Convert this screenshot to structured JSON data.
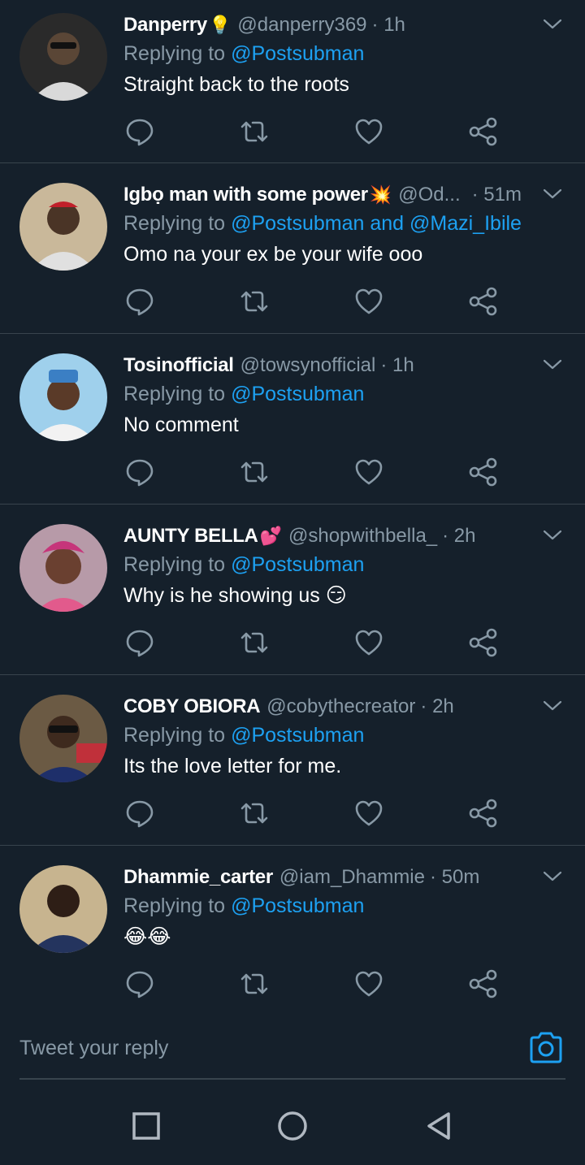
{
  "tweets": [
    {
      "name": "Danperry",
      "emoji": "💡",
      "handle": "@danperry369",
      "time": "· 1h",
      "replying_prefix": "Replying to",
      "mentions": "@Postsubman",
      "text": "Straight back to the roots",
      "avatar_color": "#3a3a3a"
    },
    {
      "name": "Igbọ man with some power",
      "emoji": "💥",
      "handle": "@Od...",
      "time": "· 51m",
      "replying_prefix": "Replying to",
      "mentions": "@Postsubman and @Mazi_Ibile",
      "text": "Omo na your ex be your wife ooo",
      "avatar_color": "#8a7a62"
    },
    {
      "name": "Tosinofficial",
      "emoji": "",
      "handle": "@towsynofficial",
      "time": "· 1h",
      "replying_prefix": "Replying to",
      "mentions": "@Postsubman",
      "text": "No comment",
      "avatar_color": "#6fa8c9"
    },
    {
      "name": "AUNTY BELLA",
      "emoji": "💕",
      "handle": "@shopwithbella_",
      "time": "· 2h",
      "replying_prefix": "Replying to",
      "mentions": "@Postsubman",
      "text": "Why is he showing us 😏",
      "avatar_color": "#a88a9c"
    },
    {
      "name": "COBY OBIORA",
      "emoji": "",
      "handle": "@cobythecreator",
      "time": "· 2h",
      "replying_prefix": "Replying to",
      "mentions": "@Postsubman",
      "text": "Its the love letter for me.",
      "avatar_color": "#5b4a3a"
    },
    {
      "name": "Dhammie_carter",
      "emoji": "",
      "handle": "@iam_Dhammie",
      "time": "· 50m",
      "replying_prefix": "Replying to",
      "mentions": "@Postsubman",
      "text": "😂😂",
      "avatar_color": "#2f3d5a"
    }
  ],
  "composer": {
    "placeholder": "Tweet your reply",
    "camera_icon": "camera-icon"
  },
  "colors": {
    "background": "#15202b",
    "divider": "#38444d",
    "secondary_text": "#8899a6",
    "accent": "#1da1f2"
  },
  "nav": {
    "icons": [
      "recents-square-icon",
      "home-circle-icon",
      "back-triangle-icon"
    ]
  }
}
